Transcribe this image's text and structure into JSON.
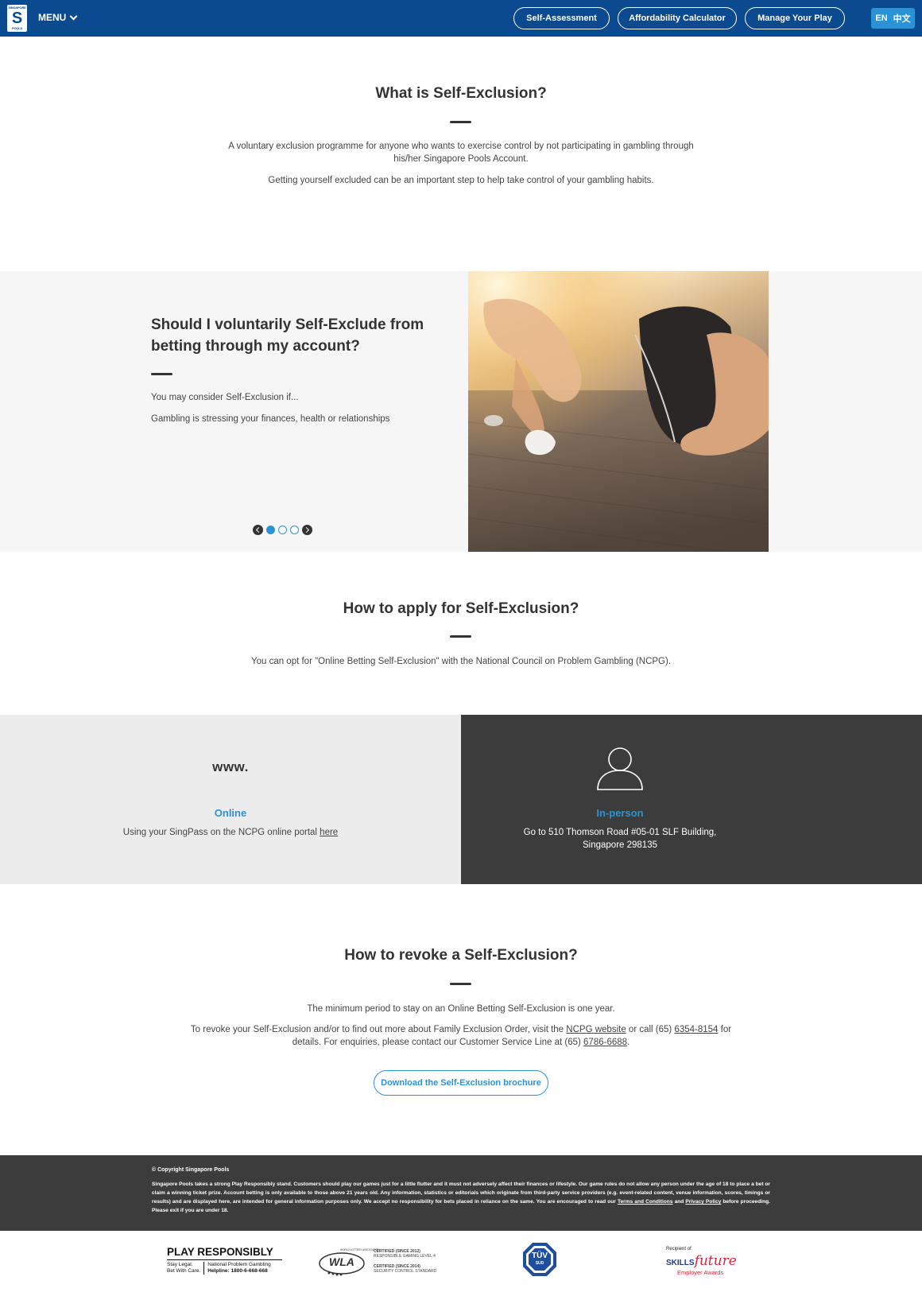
{
  "header": {
    "logo_top": "SINGAPORE",
    "logo_bottom": "POOLS",
    "menu_label": "MENU",
    "nav": [
      "Self-Assessment",
      "Affordability Calculator",
      "Manage Your Play"
    ],
    "lang_en": "EN",
    "lang_zh": "中文"
  },
  "intro": {
    "title": "What is Self-Exclusion?",
    "p1": "A voluntary exclusion programme for anyone who wants to exercise control by not participating in gambling through his/her Singapore Pools Account.",
    "p2": "Getting yourself excluded can be an important step to help take control of your gambling habits."
  },
  "carousel": {
    "title_line1": "Should I voluntarily Self-Exclude from",
    "title_line2": "betting through my account?",
    "p1": "You may consider Self-Exclusion if...",
    "p2": "Gambling is stressing your finances, health or relationships",
    "slide_count": 3,
    "active_slide": 1
  },
  "apply": {
    "title": "How to apply for Self-Exclusion?",
    "text": "You can opt for \"Online Betting Self-Exclusion\" with the National Council on Problem Gambling (NCPG).",
    "online": {
      "icon_text": "www.",
      "title": "Online",
      "text": "Using your SingPass on the NCPG online portal",
      "link": "here"
    },
    "inperson": {
      "title": "In-person",
      "line1": "Go to 510 Thomson Road #05-01 SLF Building,",
      "line2": "Singapore 298135"
    }
  },
  "revoke": {
    "title": "How to revoke a Self-Exclusion?",
    "p1": "The minimum period to stay on an Online Betting Self-Exclusion is one year.",
    "p2_a": "To revoke your Self-Exclusion and/or to find out more about Family Exclusion Order, visit the",
    "p2_link": "NCPG website",
    "p2_b": "or call (65)",
    "p2_phone": "6354-8154",
    "p2_c": "for",
    "p3_a": "details. For enquiries, please contact our Customer Service Line at (65)",
    "p3_phone": "6786-6688",
    "p3_b": ".",
    "button": "Download the Self-Exclusion brochure"
  },
  "footer": {
    "copyright": "© Copyright Singapore Pools",
    "fine": "Singapore Pools takes a strong Play Responsibly stand. Customers should play our games just for a little flutter and it must not adversely affect their finances or lifestyle. Our game rules do not allow any person under the age of 18 to place a bet or claim a winning ticket prize. Account betting is only available to those above 21 years old. Any information, statistics or editorials which originate from third-party service providers (e.g. event-related content, venue information, scores, timings or results) and are displayed here, are intended for general information purposes only. We accept no responsibility for bets placed in reliance on the same. You are encouraged to read our",
    "terms": "Terms and Conditions",
    "and": "and",
    "privacy": "Privacy Policy",
    "end": "before proceeding. Please exit if you are under 18."
  },
  "logos": {
    "pr_title": "PLAY RESPONSIBLY",
    "pr_l1": "Stay Legal.",
    "pr_l2": "Bet With Care.",
    "pr_r1": "National Problem Gambling",
    "pr_r2": "Helpline: 1800-6-668-668",
    "wla_small": "WORLD LOTTERY ASSOCIATION",
    "wla": "WLA",
    "wla_c1": "CERTIFIED (SINCE 2012)",
    "wla_c1b": "RESPONSIBLE GAMING LEVEL 4",
    "wla_c2": "CERTIFIED (SINCE 2014)",
    "wla_c2b": "SECURITY CONTROL STANDARD",
    "tuv": "TÜV",
    "tuv_sub": "SUD",
    "sk_recipient": "Recipient of",
    "sk_skills": "SKILLS",
    "sk_future": "future",
    "sk_awards": "Employer Awards"
  },
  "colors": {
    "brand_blue": "#0b4a8f",
    "accent_blue": "#2a93d5",
    "dark_panel": "#3c3c3c"
  }
}
